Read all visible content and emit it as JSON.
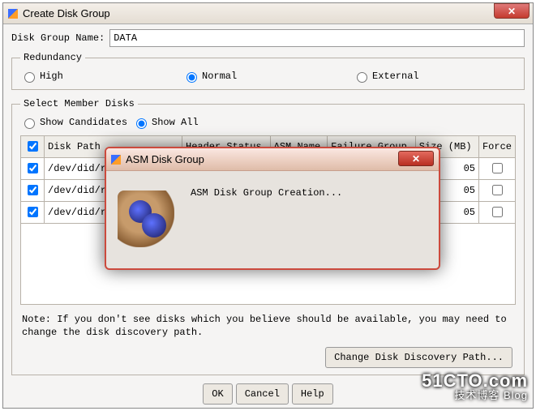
{
  "window": {
    "title": "Create Disk Group",
    "close_glyph": "✕"
  },
  "form": {
    "name_label": "Disk Group Name:",
    "name_value": "DATA"
  },
  "redundancy": {
    "legend": "Redundancy",
    "high": "High",
    "normal": "Normal",
    "external": "External",
    "selected": "normal"
  },
  "members": {
    "legend": "Select Member Disks",
    "show_candidates": "Show Candidates",
    "show_all": "Show All",
    "show_selected": "all",
    "columns": {
      "disk_path": "Disk Path",
      "header_status": "Header Status",
      "asm_name": "ASM Name",
      "failure_group": "Failure Group",
      "size_mb": "Size (MB)",
      "force": "Force"
    },
    "rows": [
      {
        "checked": true,
        "disk_path": "/dev/did/r",
        "size_tail": "05",
        "force": false
      },
      {
        "checked": true,
        "disk_path": "/dev/did/r",
        "size_tail": "05",
        "force": false
      },
      {
        "checked": true,
        "disk_path": "/dev/did/r",
        "size_tail": "05",
        "force": false
      }
    ]
  },
  "note": "Note: If you don't see disks which you believe should be available, you may need to change the disk discovery path.",
  "buttons": {
    "change_path": "Change Disk Discovery Path...",
    "ok": "OK",
    "cancel": "Cancel",
    "help": "Help"
  },
  "modal": {
    "title": "ASM Disk Group",
    "message": "ASM Disk Group Creation...",
    "close_glyph": "✕"
  },
  "watermark": {
    "line1": "51CTO.com",
    "line2": "技术博客    Blog"
  }
}
